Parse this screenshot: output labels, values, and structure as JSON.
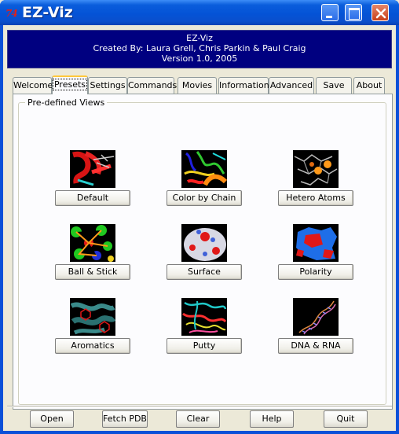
{
  "window": {
    "title": "EZ-Viz",
    "app_icon_glyph": "74",
    "controls": [
      "minimize-icon",
      "maximize-icon",
      "close-icon"
    ]
  },
  "banner": {
    "line1": "EZ-Viz",
    "line2": "Created By: Laura Grell, Chris Parkin & Paul Craig",
    "line3": "Version 1.0, 2005"
  },
  "tabs": [
    {
      "label": "Welcome"
    },
    {
      "label": "Presets",
      "active": true
    },
    {
      "label": "Settings"
    },
    {
      "label": "Commands"
    },
    {
      "label": "Movies"
    },
    {
      "label": "Information"
    },
    {
      "label": "Advanced"
    },
    {
      "label": "Save"
    },
    {
      "label": "About"
    }
  ],
  "presets_panel": {
    "group_title": "Pre-defined Views",
    "items": [
      {
        "label": "Default",
        "thumb": "cartoon-red-thumbnail"
      },
      {
        "label": "Color by Chain",
        "thumb": "chain-colored-thumbnail"
      },
      {
        "label": "Hetero Atoms",
        "thumb": "hetero-atoms-thumbnail"
      },
      {
        "label": "Ball & Stick",
        "thumb": "ball-stick-thumbnail"
      },
      {
        "label": "Surface",
        "thumb": "surface-thumbnail"
      },
      {
        "label": "Polarity",
        "thumb": "polarity-thumbnail"
      },
      {
        "label": "Aromatics",
        "thumb": "aromatics-thumbnail"
      },
      {
        "label": "Putty",
        "thumb": "putty-thumbnail"
      },
      {
        "label": "DNA & RNA",
        "thumb": "dna-rna-thumbnail"
      }
    ]
  },
  "bottom_buttons": [
    {
      "label": "Open"
    },
    {
      "label": "Fetch PDB"
    },
    {
      "label": "Clear"
    },
    {
      "label": "Help"
    },
    {
      "label": "Quit"
    }
  ],
  "colors": {
    "banner_bg": "#000080",
    "titlebar_blue": "#0453d6",
    "active_tab_highlight": "#ffc83c",
    "dialog_bg": "#ece9d8"
  }
}
